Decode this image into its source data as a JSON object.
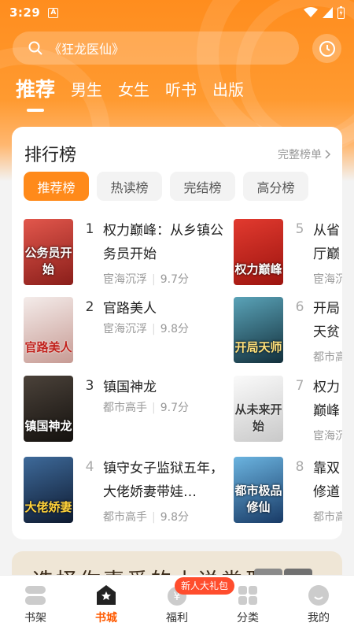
{
  "status": {
    "time": "3:29",
    "app_badge": "A"
  },
  "search": {
    "placeholder": "《狂龙医仙》"
  },
  "tabs": [
    {
      "label": "推荐",
      "active": true
    },
    {
      "label": "男生"
    },
    {
      "label": "女生"
    },
    {
      "label": "听书"
    },
    {
      "label": "出版"
    }
  ],
  "ranking": {
    "title": "排行榜",
    "full_list": "完整榜单",
    "chips": [
      "推荐榜",
      "热读榜",
      "完结榜",
      "高分榜"
    ],
    "books": [
      {
        "rank": "1",
        "title": "权力巅峰：从乡镇公务员开始",
        "category": "宦海沉浮",
        "score": "9.7分",
        "cover_text": "公务员开始",
        "cover_color": "#b8342e"
      },
      {
        "rank": "2",
        "title": "官路美人",
        "category": "宦海沉浮",
        "score": "9.8分",
        "cover_text": "官路美人",
        "cover_color": "#d9c7c0"
      },
      {
        "rank": "3",
        "title": "镇国神龙",
        "category": "都市高手",
        "score": "9.7分",
        "cover_text": "镇国神龙",
        "cover_color": "#2b2622"
      },
      {
        "rank": "4",
        "title": "镇守女子监狱五年，大佬娇妻带娃…",
        "category": "都市高手",
        "score": "9.8分",
        "cover_text": "大佬娇妻",
        "cover_color": "#1f3552"
      },
      {
        "rank": "5",
        "title": "从省厅巅峰",
        "category": "宦海沉浮",
        "score": "",
        "cover_text": "权力巅峰",
        "cover_color": "#c8261d"
      },
      {
        "rank": "6",
        "title": "开局天贫道…",
        "category": "都市高手",
        "score": "",
        "cover_text": "开局天师",
        "cover_color": "#2a5a6a"
      },
      {
        "rank": "7",
        "title": "权力巅峰未来开…",
        "category": "宦海沉浮",
        "score": "",
        "cover_text": "从未来开始",
        "cover_color": "#e9e9e9"
      },
      {
        "rank": "8",
        "title": "靠双修道我…",
        "category": "都市高手",
        "score": "",
        "cover_text": "都市极品修仙",
        "cover_color": "#2c6a9a"
      }
    ]
  },
  "banner": {
    "text": "选择你喜爱的小说类型"
  },
  "bottom_nav": [
    {
      "label": "书架",
      "icon": "bookshelf-icon"
    },
    {
      "label": "书城",
      "icon": "bookstore-icon",
      "active": true
    },
    {
      "label": "福利",
      "icon": "welfare-icon"
    },
    {
      "label": "分类",
      "icon": "category-icon"
    },
    {
      "label": "我的",
      "icon": "profile-icon"
    }
  ],
  "gift_badge": "新人大礼包",
  "colors": {
    "accent": "#ff8a1a",
    "active_nav": "#ff5a00"
  }
}
